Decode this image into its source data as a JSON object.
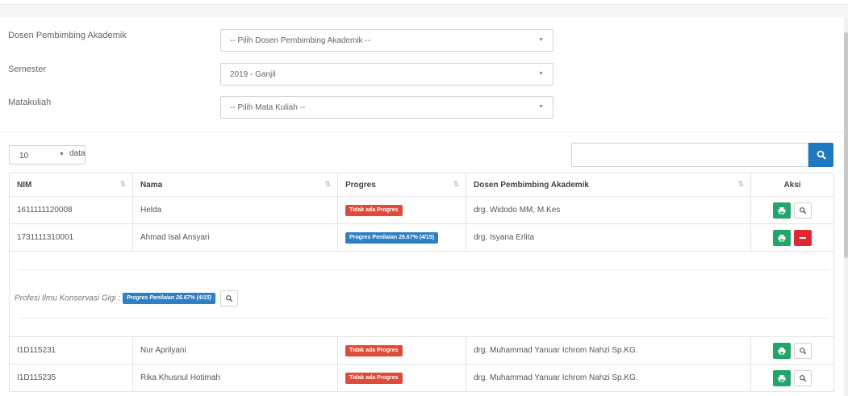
{
  "form": {
    "dosen_label": "Dosen Pembimbing Akademik",
    "dosen_value": "-- Pilih Dosen Pembimbing Akademik --",
    "semester_label": "Semester",
    "semester_value": "2019 - Ganjil",
    "matakuliah_label": "Matakuliah",
    "matakuliah_value": "-- Pilih Mata Kuliah --"
  },
  "table_controls": {
    "page_length": "10",
    "page_length_suffix": "data",
    "search_value": ""
  },
  "table": {
    "columns": [
      "NIM",
      "Nama",
      "Progres",
      "Dosen Pembimbing Akademik",
      "Aksi"
    ],
    "rows": [
      {
        "nim": "1611111120008",
        "nama": "Helda",
        "progres": "Tidak ada Progres",
        "progres_status": "none",
        "dosen": "drg. Widodo MM, M.Kes"
      },
      {
        "nim": "1731111310001",
        "nama": "Ahmad Isal Ansyari",
        "progres": "Progres Penilaian 26.67% (4/15)",
        "progres_status": "progress",
        "dosen": "drg. Isyana Erlita"
      },
      {
        "nim": "I1D115231",
        "nama": "Nur Aprilyani",
        "progres": "Tidak ada Progres",
        "progres_status": "none",
        "dosen": "drg. Muhammad Yanuar Ichrom Nahzi Sp.KG."
      },
      {
        "nim": "I1D115235",
        "nama": "Rika Khusnul Hotimah",
        "progres": "Tidak ada Progres",
        "progres_status": "none",
        "dosen": "drg. Muhammad Yanuar Ichrom Nahzi Sp.KG."
      }
    ],
    "detail": {
      "label": "Profesi Ilmu Konservasi Gigi :",
      "badge": "Progres Penilaian 26.67% (4/15)"
    }
  },
  "colors": {
    "primary": "#1f79c2",
    "success": "#22a46a",
    "danger": "#dd4b39",
    "info_badge": "#2f7fc4"
  },
  "icons": {
    "row_action_print": "print-icon",
    "row_action_view": "search-icon",
    "row_action_collapse": "minus-icon",
    "search_button": "search-icon",
    "sort": "sort-icon"
  }
}
